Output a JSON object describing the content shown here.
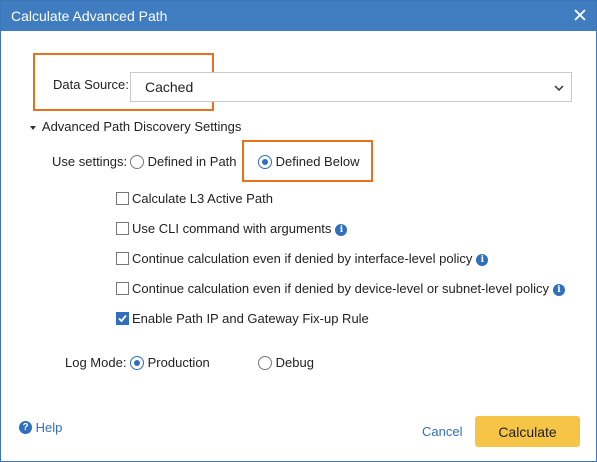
{
  "window": {
    "title": "Calculate Advanced Path"
  },
  "data_source": {
    "label": "Data Source:",
    "value": "Cached"
  },
  "section": {
    "title": "Advanced Path Discovery Settings"
  },
  "use_settings": {
    "label": "Use settings:",
    "options": [
      {
        "label": "Defined in Path",
        "selected": false
      },
      {
        "label": "Defined Below",
        "selected": true
      }
    ]
  },
  "checkboxes": [
    {
      "label": "Calculate L3 Active Path",
      "checked": false,
      "info": false
    },
    {
      "label": "Use CLI command with arguments",
      "checked": false,
      "info": true
    },
    {
      "label": "Continue calculation even if denied by interface-level policy",
      "checked": false,
      "info": true
    },
    {
      "label": "Continue calculation even if denied by device-level or subnet-level policy",
      "checked": false,
      "info": true
    },
    {
      "label": "Enable Path IP and Gateway Fix-up Rule",
      "checked": true,
      "info": false
    }
  ],
  "log_mode": {
    "label": "Log Mode:",
    "options": [
      {
        "label": "Production",
        "selected": true
      },
      {
        "label": "Debug",
        "selected": false
      }
    ]
  },
  "footer": {
    "help": "Help",
    "cancel": "Cancel",
    "calculate": "Calculate"
  },
  "colors": {
    "title_bar": "#3f7cc0",
    "accent": "#2f6fbd",
    "highlight": "#e8711e",
    "primary_button": "#f6c547"
  }
}
